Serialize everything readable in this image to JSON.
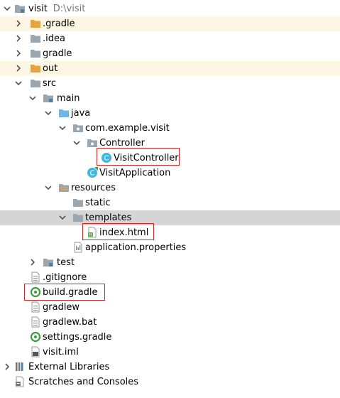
{
  "tree": {
    "root_label": "visit",
    "root_path": "D:\\visit",
    "items": {
      "gradle_hidden": ".gradle",
      "idea": ".idea",
      "gradle": "gradle",
      "out": "out",
      "src": "src",
      "main": "main",
      "java": "java",
      "package": "com.example.visit",
      "controller_pkg": "Controller",
      "visit_controller": "VisitController",
      "visit_application": "VisitApplication",
      "resources": "resources",
      "static": "static",
      "templates": "templates",
      "index_html": "index.html",
      "app_properties": "application.properties",
      "test": "test",
      "gitignore": ".gitignore",
      "build_gradle": "build.gradle",
      "gradlew": "gradlew",
      "gradlew_bat": "gradlew.bat",
      "settings_gradle": "settings.gradle",
      "visit_iml": "visit.iml",
      "external_libraries": "External Libraries",
      "scratches": "Scratches and Consoles"
    }
  },
  "colors": {
    "folder_gray": "#9aa7b0",
    "folder_orange": "#e8a33d",
    "folder_blue": "#6fb6e8",
    "class_icon": "#40b6e0",
    "gradle_green": "#3d9b3d",
    "selection": "#d5d5d5",
    "highlight_box": "#e02020"
  }
}
